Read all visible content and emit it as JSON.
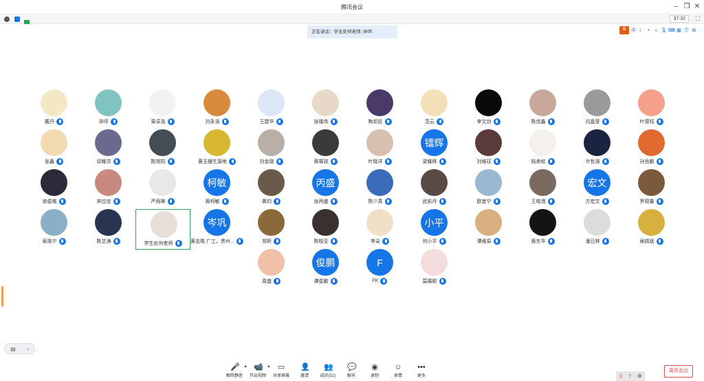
{
  "window": {
    "title": "腾讯会议",
    "minimize_icon": "minimize-icon",
    "restore_icon": "restore-icon",
    "close_icon": "close-icon"
  },
  "infobar": {
    "timer": "37:32",
    "icons": [
      "info-icon",
      "shield-icon",
      "signal-icon",
      "fullscreen-icon"
    ]
  },
  "speaking_banner": "正在讲话：学生处何老师; 钟坪;",
  "ime_toolbar": {
    "logo": "S",
    "label": "中",
    "items": [
      "moon-icon",
      "dot-icon",
      "smile-icon",
      "mic-icon",
      "keyboard-icon",
      "grid-icon",
      "shirt-icon",
      "apps-icon"
    ]
  },
  "participants": [
    {
      "name": "戴丹",
      "bg": "#f4e7c3",
      "avatar_text": ""
    },
    {
      "name": "钟坪",
      "bg": "#7fc4c0",
      "avatar_text": ""
    },
    {
      "name": "蒋卓浩",
      "bg": "#f2f2f2",
      "avatar_text": ""
    },
    {
      "name": "刘永浩",
      "bg": "#d88a3c",
      "avatar_text": ""
    },
    {
      "name": "王建华",
      "bg": "#dde6f5",
      "avatar_text": ""
    },
    {
      "name": "张雄伟",
      "bg": "#e8d8c8",
      "avatar_text": ""
    },
    {
      "name": "陶炬民",
      "bg": "#4a3a6a",
      "avatar_text": ""
    },
    {
      "name": "范云",
      "bg": "#f3e0b8",
      "avatar_text": ""
    },
    {
      "name": "李文剑",
      "bg": "#0a0a0a",
      "avatar_text": ""
    },
    {
      "name": "陈佳鑫",
      "bg": "#c8a89a",
      "avatar_text": ""
    },
    {
      "name": "闫晶莹",
      "bg": "#9a9a9a",
      "avatar_text": ""
    },
    {
      "name": "叶德钰",
      "bg": "#f4a08a",
      "avatar_text": ""
    },
    {
      "name": "张鑫",
      "bg": "#f3d9b0",
      "avatar_text": ""
    },
    {
      "name": "邱耀洪",
      "bg": "#6a6a90",
      "avatar_text": ""
    },
    {
      "name": "陈旭阳",
      "bg": "#444c55",
      "avatar_text": ""
    },
    {
      "name": "黄玉姗生源地",
      "bg": "#d8b830",
      "avatar_text": ""
    },
    {
      "name": "刘金刚",
      "bg": "#b8b0a8",
      "avatar_text": ""
    },
    {
      "name": "黄骞锐",
      "bg": "#3a3a3a",
      "avatar_text": ""
    },
    {
      "name": "叶晓洋",
      "bg": "#d8c0b0",
      "avatar_text": ""
    },
    {
      "name": "梁耀辉",
      "bg": "#1676e8",
      "avatar_text": "镭辉"
    },
    {
      "name": "刘维珏",
      "bg": "#5a3a3a",
      "avatar_text": ""
    },
    {
      "name": "陆承权",
      "bg": "#f4f0ea",
      "avatar_text": ""
    },
    {
      "name": "许哲源",
      "bg": "#1a2440",
      "avatar_text": ""
    },
    {
      "name": "孙岳鹏",
      "bg": "#e06a30",
      "avatar_text": ""
    },
    {
      "name": "徐俊楷",
      "bg": "#2a2a3a",
      "avatar_text": ""
    },
    {
      "name": "宋应忠",
      "bg": "#c88a80",
      "avatar_text": ""
    },
    {
      "name": "严雨琳",
      "bg": "#e8e8e8",
      "avatar_text": ""
    },
    {
      "name": "黄柯敏",
      "bg": "#1676e8",
      "avatar_text": "柯敏"
    },
    {
      "name": "黄钧",
      "bg": "#6a5a4a",
      "avatar_text": ""
    },
    {
      "name": "张丙盛",
      "bg": "#1676e8",
      "avatar_text": "丙盛"
    },
    {
      "name": "陈少真",
      "bg": "#3a6ab8",
      "avatar_text": ""
    },
    {
      "name": "武凯丹",
      "bg": "#5a4a44",
      "avatar_text": ""
    },
    {
      "name": "欧宜宁",
      "bg": "#9ab8d0",
      "avatar_text": ""
    },
    {
      "name": "王晓洒",
      "bg": "#7a6a60",
      "avatar_text": ""
    },
    {
      "name": "方宏文",
      "bg": "#1676e8",
      "avatar_text": "宏文"
    },
    {
      "name": "罗观量",
      "bg": "#7a5a3a",
      "avatar_text": ""
    },
    {
      "name": "吴珠宁",
      "bg": "#8ab0c8",
      "avatar_text": ""
    },
    {
      "name": "陈芝涛",
      "bg": "#2a3450",
      "avatar_text": ""
    },
    {
      "name": "学生处何老师",
      "bg": "#e8e0d8",
      "avatar_text": ""
    },
    {
      "name": "黄志皓 广工，贵州...",
      "bg": "#1676e8",
      "avatar_text": "岑巩"
    },
    {
      "name": "郑昕",
      "bg": "#8a6a3a",
      "avatar_text": ""
    },
    {
      "name": "陈晓亚",
      "bg": "#3a3030",
      "avatar_text": ""
    },
    {
      "name": "李朵",
      "bg": "#f0e0c8",
      "avatar_text": ""
    },
    {
      "name": "何小平",
      "bg": "#1676e8",
      "avatar_text": "小平"
    },
    {
      "name": "谭维易",
      "bg": "#d8b080",
      "avatar_text": ""
    },
    {
      "name": "黄东华",
      "bg": "#141414",
      "avatar_text": ""
    },
    {
      "name": "潘日林",
      "bg": "#dcdcdc",
      "avatar_text": ""
    },
    {
      "name": "侯婧斌",
      "bg": "#d8b040",
      "avatar_text": ""
    },
    {
      "name": "周盛",
      "bg": "#f0c0a8",
      "avatar_text": ""
    },
    {
      "name": "谭俊鹏",
      "bg": "#1676e8",
      "avatar_text": "俊鹏"
    },
    {
      "name": "FK",
      "bg": "#1676e8",
      "avatar_text": "F"
    },
    {
      "name": "莫展聪",
      "bg": "#f4dcdc",
      "avatar_text": ""
    }
  ],
  "toolbar": [
    {
      "label": "解除静音",
      "icon": "🎤",
      "name": "unmute-button"
    },
    {
      "label": "开启视频",
      "icon": "📹",
      "name": "start-video-button"
    },
    {
      "label": "共享屏幕",
      "icon": "▭",
      "name": "share-screen-button"
    },
    {
      "label": "邀请",
      "icon": "👤",
      "name": "invite-button"
    },
    {
      "label": "成员(52)",
      "icon": "👥",
      "name": "members-button"
    },
    {
      "label": "聊天",
      "icon": "💬",
      "name": "chat-button"
    },
    {
      "label": "录制",
      "icon": "◉",
      "name": "record-button"
    },
    {
      "label": "表情",
      "icon": "☺",
      "name": "emoji-button"
    },
    {
      "label": "更多",
      "icon": "•••",
      "name": "more-button"
    }
  ],
  "leave_label": "离开会议",
  "layout_toggle": {
    "left": "▤",
    "right": "‹"
  }
}
